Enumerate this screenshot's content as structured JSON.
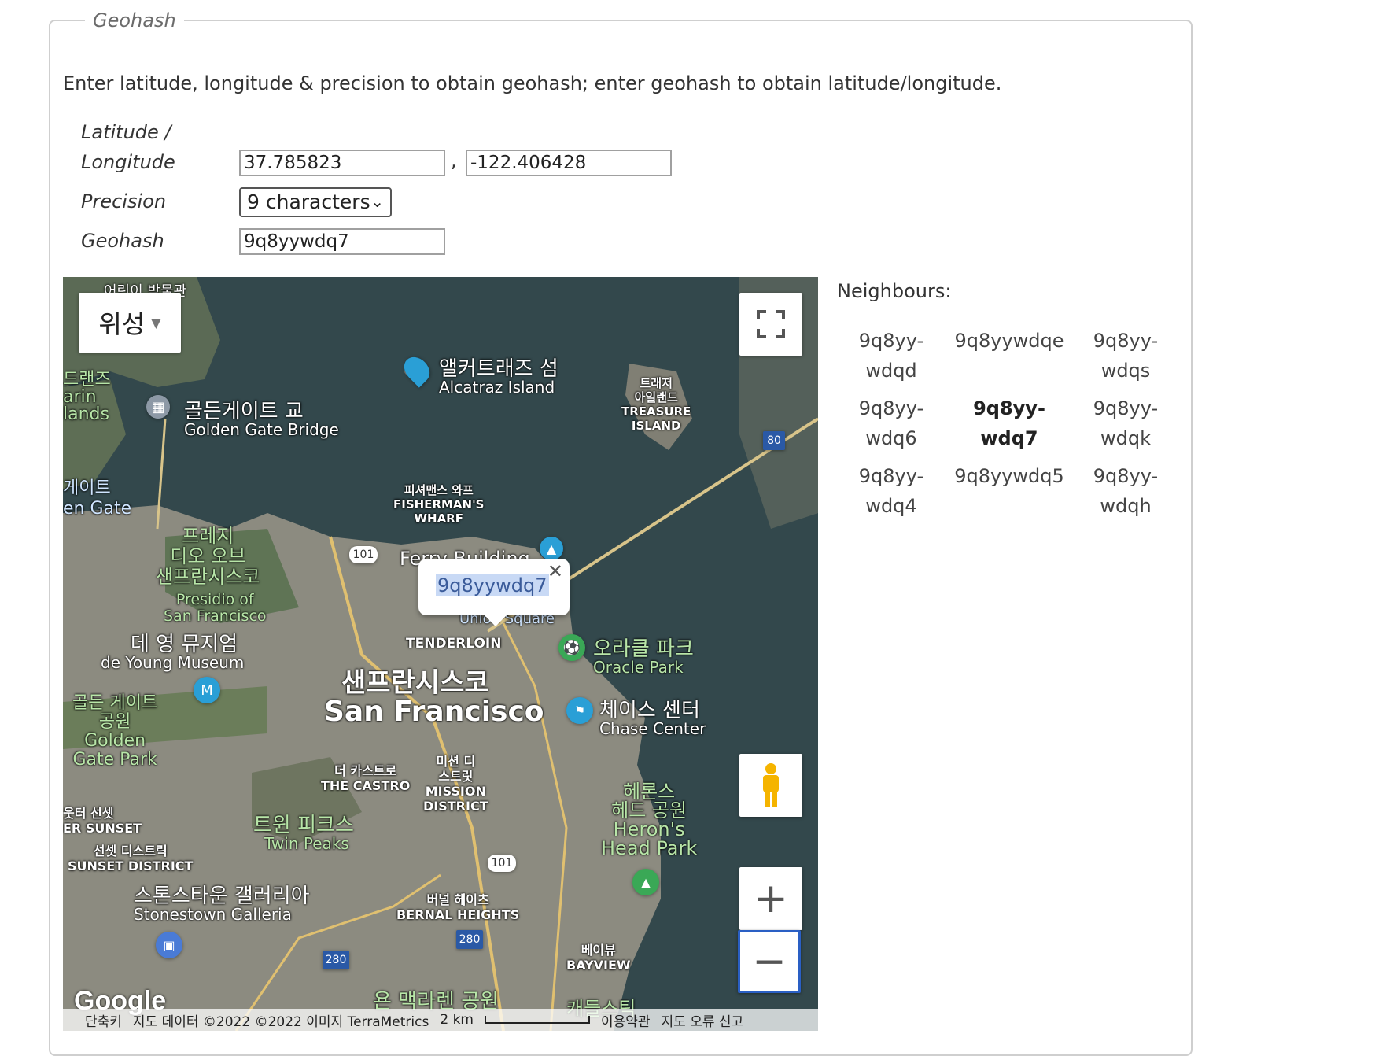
{
  "fieldset": {
    "legend": "Geohash"
  },
  "intro": "Enter latitude, longitude & precision to obtain geohash; enter geohash to obtain latitude/longitude.",
  "form": {
    "latlon_label_1": "Latitude /",
    "latlon_label_2": "Longitude",
    "latitude": "37.785823",
    "comma": ",",
    "longitude": "-122.406428",
    "precision_label": "Precision",
    "precision_value": "9 characters",
    "geohash_label": "Geohash",
    "geohash_value": "9q8yywdq7"
  },
  "map": {
    "type_button": "위성",
    "popup_geohash": "9q8yywdq7",
    "labels": {
      "alcatraz_ko": "앨커트래즈 섬",
      "alcatraz_en": "Alcatraz Island",
      "ggb_ko": "골든게이트 교",
      "ggb_en": "Golden Gate Bridge",
      "treasure": "트래저\n아일랜드\nTREASURE\nISLAND",
      "wharf": "피셔맨스 와프\nFISHERMAN'S\nWHARF",
      "presidio": "프레지\n디오 오브\n샌프란시스코",
      "presidio_en": "Presidio of\nSan Francisco",
      "deyoung_ko": "데 영 뮤지엄",
      "deyoung_en": "de Young Museum",
      "sf_ko": "샌프란시스코",
      "sf_en": "San Francisco",
      "tenderloin": "TENDERLOIN",
      "oracle_ko": "오라클 파크",
      "oracle_en": "Oracle Park",
      "chase_ko": "체이스 센터",
      "chase_en": "Chase Center",
      "ggpark": "골든 게이트\n공원\nGolden\nGate Park",
      "castro": "더 카스트로\nTHE CASTRO",
      "mission": "미션 디\n스트릿\nMISSION\nDISTRICT",
      "twinpeaks_ko": "트윈 피크스",
      "twinpeaks_en": "Twin Peaks",
      "herons": "헤론스\n헤드 공원\nHeron's\nHead Park",
      "sunset": "선셋 디스트릭\nSUNSET DISTRICT",
      "outer_sunset": "웃터 선셋\nER SUNSET",
      "stonestown_ko": "스톤스타운 갤러리아",
      "stonestown_en": "Stonestown Galleria",
      "bernal": "버널 헤이츠\nBERNAL HEIGHTS",
      "bayview": "베이뷰\nBAYVIEW",
      "mclaren": "욘 맥라렌 공원",
      "ferry": "Ferry Building",
      "union": "Union Square",
      "marin": "드랜즈\narin\nlands",
      "goldengate_left": "게이트\nen Gate",
      "children_museum": "어린이 박물관",
      "candlestick": "캐들스틱",
      "hwy101a": "101",
      "hwy101b": "101",
      "hwy80": "80",
      "hwy280a": "280",
      "hwy280b": "280"
    },
    "logo": "Google",
    "footer": {
      "shortcuts": "단축키",
      "data": "지도 데이터 ©2022 ©2022 이미지 TerraMetrics",
      "scale": "2 km",
      "terms": "이용약관",
      "report": "지도 오류 신고"
    }
  },
  "neighbours": {
    "title": "Neighbours:",
    "cells": [
      "9q8yy-\nwdqd",
      "9q8yywdqe",
      "9q8yy-\nwdqs",
      "9q8yy-\nwdq6",
      "9q8yy-\nwdq7",
      "9q8yy-\nwdqk",
      "9q8yy-\nwdq4",
      "9q8yywdq5",
      "9q8yy-\nwdqh"
    ]
  }
}
